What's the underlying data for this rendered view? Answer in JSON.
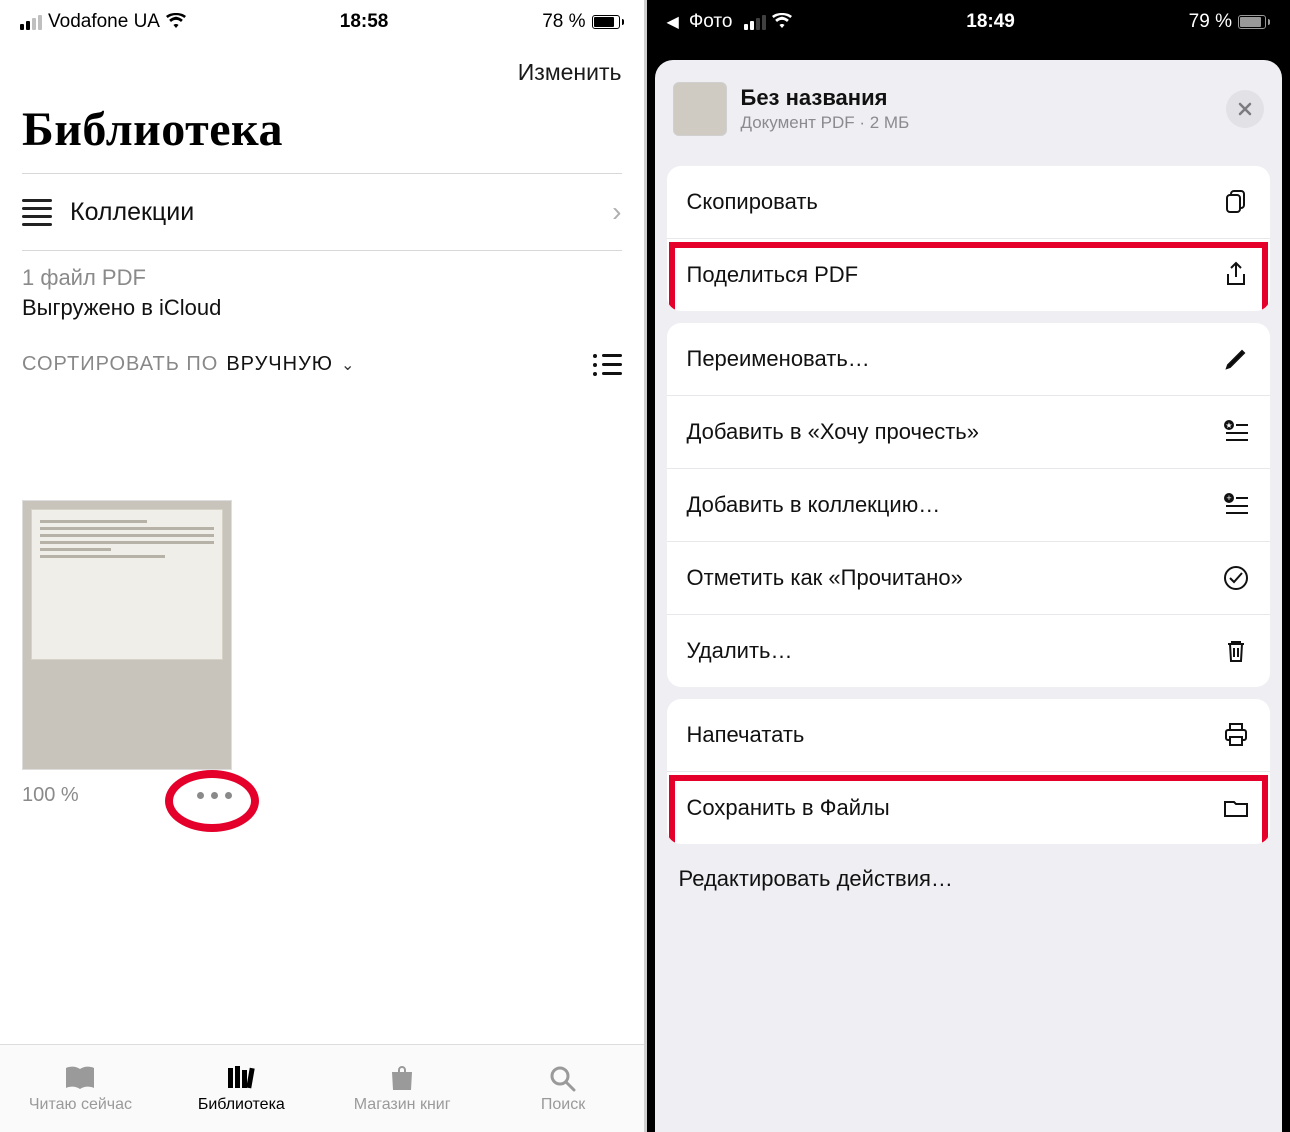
{
  "left": {
    "status": {
      "carrier": "Vodafone UA",
      "time": "18:58",
      "battery": "78 %"
    },
    "edit": "Изменить",
    "title": "Библиотека",
    "collections": "Коллекции",
    "file_count": "1 файл PDF",
    "icloud": "Выгружено в iCloud",
    "sort_label": "СОРТИРОВАТЬ ПО",
    "sort_value": "ВРУЧНУЮ",
    "progress": "100 %",
    "tabs": {
      "reading": "Читаю сейчас",
      "library": "Библиотека",
      "store": "Магазин книг",
      "search": "Поиск"
    }
  },
  "right": {
    "status": {
      "back_app": "Фото",
      "time": "18:49",
      "battery": "79 %"
    },
    "doc": {
      "title": "Без названия",
      "subtitle": "Документ PDF · 2 МБ"
    },
    "actions": {
      "copy": "Скопировать",
      "share": "Поделиться PDF",
      "rename": "Переименовать…",
      "want": "Добавить в «Хочу прочесть»",
      "collection": "Добавить в коллекцию…",
      "read": "Отметить как «Прочитано»",
      "delete": "Удалить…",
      "print": "Напечатать",
      "save": "Сохранить в Файлы"
    },
    "edit_actions": "Редактировать действия…"
  }
}
